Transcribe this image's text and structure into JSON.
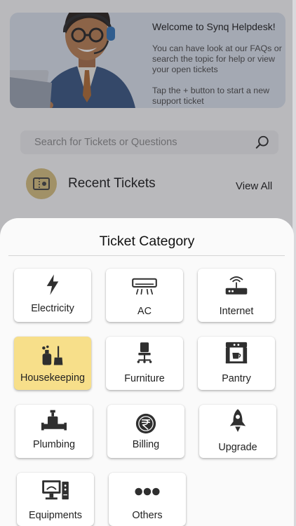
{
  "hero": {
    "title": "Welcome to Synq Helpdesk!",
    "body": "You can have look at our FAQs or search the topic for help or view your open tickets",
    "hint": "Tap the + button to start a new support ticket",
    "illustration": "support-agent-at-laptop"
  },
  "search": {
    "placeholder": "Search for Tickets or Questions",
    "icon": "search-icon"
  },
  "recent": {
    "title": "Recent Tickets",
    "view_all": "View All",
    "icon": "ticket-icon"
  },
  "sheet": {
    "title": "Ticket Category",
    "selected": "Housekeeping",
    "categories": [
      {
        "label": "Electricity",
        "icon": "lightning-icon"
      },
      {
        "label": "AC",
        "icon": "air-conditioner-icon"
      },
      {
        "label": "Internet",
        "icon": "router-icon"
      },
      {
        "label": "Housekeeping",
        "icon": "cleaning-icon"
      },
      {
        "label": "Furniture",
        "icon": "office-chair-icon"
      },
      {
        "label": "Pantry",
        "icon": "coffee-machine-icon"
      },
      {
        "label": "Plumbing",
        "icon": "pipe-icon"
      },
      {
        "label": "Billing",
        "icon": "rupee-coin-icon"
      },
      {
        "label": "Upgrade",
        "icon": "rocket-icon"
      },
      {
        "label": "Equipments",
        "icon": "computer-icon"
      },
      {
        "label": "Others",
        "icon": "more-dots-icon"
      }
    ]
  },
  "colors": {
    "selected_tile": "#f7df8a",
    "hero_bg": "#dfe6f1",
    "icon_dark": "#2f2f2f"
  }
}
